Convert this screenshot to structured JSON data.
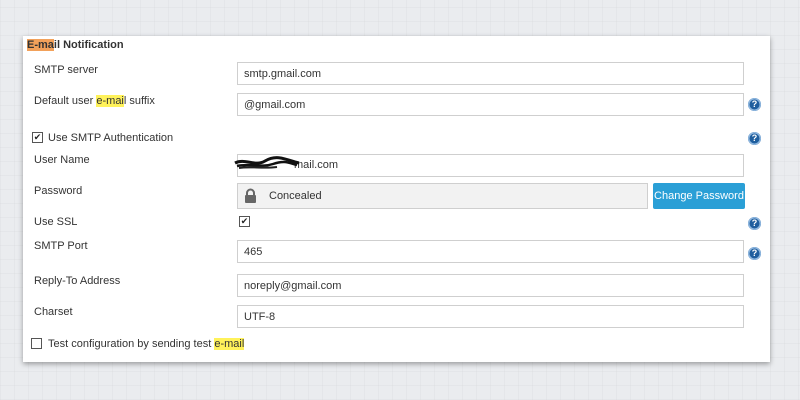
{
  "section": {
    "title_part1": "E-ma",
    "title_part2": "il Notification"
  },
  "smtp_server": {
    "label": "SMTP server",
    "value": "smtp.gmail.com"
  },
  "email_suffix": {
    "label_part1": "Default user ",
    "label_part2": "e-mai",
    "label_part3": "l suffix",
    "value": "@gmail.com"
  },
  "smtp_auth": {
    "label": "Use SMTP Authentication",
    "checked": true
  },
  "username": {
    "label": "User Name",
    "value_visible": "mail.com"
  },
  "password": {
    "label": "Password",
    "value": "Concealed",
    "change_button": "Change Password"
  },
  "use_ssl": {
    "label": "Use SSL",
    "checked": true
  },
  "smtp_port": {
    "label": "SMTP Port",
    "value": "465"
  },
  "reply_to": {
    "label": "Reply-To Address",
    "value": "noreply@gmail.com"
  },
  "charset": {
    "label": "Charset",
    "value": "UTF-8"
  },
  "test_config": {
    "label_part1": "Test configuration by sending test ",
    "label_part2": "e-mail",
    "checked": false
  },
  "help_icon_glyph": "?",
  "check_glyph": "✔",
  "colors": {
    "accent_button": "#2a9fd6",
    "help_icon": "#1f5e9e",
    "highlight_orange": "#f2a15a",
    "highlight_yellow": "#fff25a"
  }
}
